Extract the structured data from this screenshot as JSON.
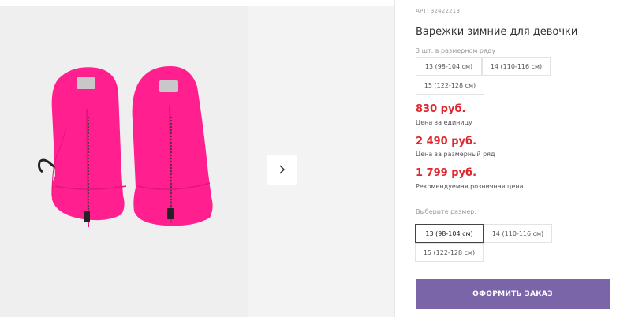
{
  "product": {
    "sku": "АРТ: 32422213",
    "title": "Варежки зимние для девочки",
    "row_note": "3 шт. в размерном ряду",
    "row_sizes": [
      "13 (98-104 см)",
      "14 (110-116 см)",
      "15 (122-128 см)"
    ],
    "unit_price": "830 руб.",
    "unit_price_note": "Цена за единицу",
    "row_price": "2 490 руб.",
    "row_price_note": "Цена за размерный ряд",
    "retail_price": "1 799 руб.",
    "retail_price_note": "Рекомендуемая розничная цена",
    "choose_size_label": "Выберите размер:",
    "size_options": [
      "13 (98-104 см)",
      "14 (110-116 см)",
      "15 (122-128 см)"
    ],
    "selected_size": "13 (98-104 см)",
    "order_button": "ОФОРМИТЬ ЗАКАЗ"
  },
  "gallery": {
    "next_icon": "chevron-right-icon",
    "image": "pink-mittens-photo"
  },
  "colors": {
    "accent": "#7a65a8",
    "price": "#e0262f",
    "mitten": "#ff1f8e"
  }
}
